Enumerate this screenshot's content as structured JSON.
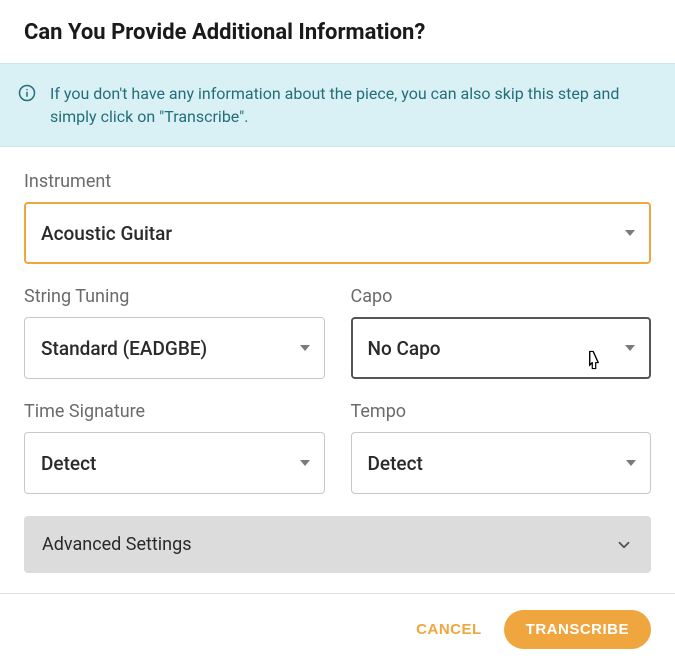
{
  "title": "Can You Provide Additional Information?",
  "info_text": "If you don't have any information about the piece, you can also skip this step and simply click on \"Transcribe\".",
  "fields": {
    "instrument": {
      "label": "Instrument",
      "value": "Acoustic Guitar"
    },
    "tuning": {
      "label": "String Tuning",
      "value": "Standard (EADGBE)"
    },
    "capo": {
      "label": "Capo",
      "value": "No Capo"
    },
    "time_signature": {
      "label": "Time Signature",
      "value": "Detect"
    },
    "tempo": {
      "label": "Tempo",
      "value": "Detect"
    }
  },
  "advanced_label": "Advanced Settings",
  "buttons": {
    "cancel": "CANCEL",
    "transcribe": "TRANSCRIBE"
  }
}
